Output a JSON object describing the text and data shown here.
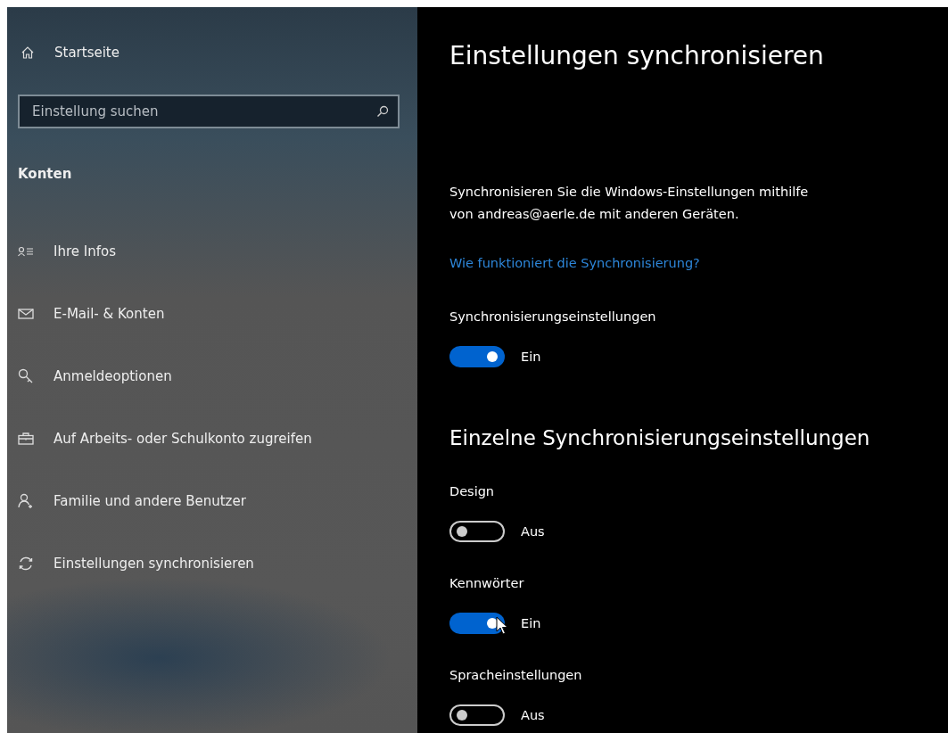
{
  "sidebar": {
    "home": "Startseite",
    "search": {
      "placeholder": "Einstellung suchen"
    },
    "section": "Konten",
    "items": [
      {
        "label": "Ihre Infos",
        "selected": false
      },
      {
        "label": "E-Mail- & Konten",
        "selected": false
      },
      {
        "label": "Anmeldeoptionen",
        "selected": false
      },
      {
        "label": "Auf Arbeits- oder Schulkonto zugreifen",
        "selected": false
      },
      {
        "label": "Familie und andere Benutzer",
        "selected": false
      },
      {
        "label": "Einstellungen synchronisieren",
        "selected": false
      }
    ]
  },
  "main": {
    "title": "Einstellungen synchronisieren",
    "description": "Synchronisieren Sie die Windows-Einstellungen mithilfe von andreas@aerle.de mit anderen Geräten.",
    "link": "Wie funktioniert die Synchronisierung?",
    "master": {
      "label": "Synchronisierungseinstellungen",
      "on": true,
      "state_text": "Ein",
      "pointer": false
    },
    "subheading": "Einzelne Synchronisierungseinstellungen",
    "toggles": [
      {
        "label": "Design",
        "on": false,
        "state_text": "Aus",
        "pointer": false
      },
      {
        "label": "Kennwörter",
        "on": true,
        "state_text": "Ein",
        "pointer": true
      },
      {
        "label": "Spracheinstellungen",
        "on": false,
        "state_text": "Aus",
        "pointer": false
      }
    ]
  }
}
